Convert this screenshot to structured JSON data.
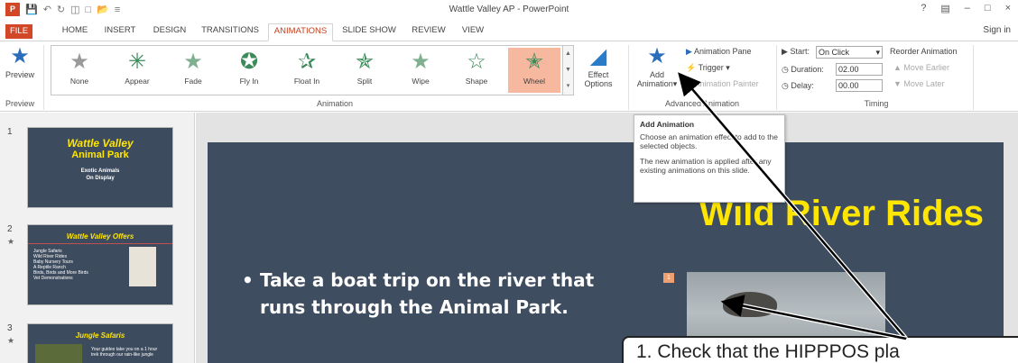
{
  "window": {
    "title": "Wattle Valley AP - PowerPoint",
    "help": "?",
    "controls": [
      "–",
      "□",
      "×"
    ]
  },
  "tabs": [
    "FILE",
    "HOME",
    "INSERT",
    "DESIGN",
    "TRANSITIONS",
    "ANIMATIONS",
    "SLIDE SHOW",
    "REVIEW",
    "VIEW"
  ],
  "active_tab": "ANIMATIONS",
  "signin": "Sign in",
  "ribbon": {
    "preview": {
      "label": "Preview",
      "group": "Preview"
    },
    "animations": [
      "None",
      "Appear",
      "Fade",
      "Fly In",
      "Float In",
      "Split",
      "Wipe",
      "Shape",
      "Wheel"
    ],
    "selected_animation": "Wheel",
    "effect_options": [
      "Effect",
      "Options"
    ],
    "animation_group": "Animation",
    "add_animation": [
      "Add",
      "Animation"
    ],
    "animation_pane": "Animation Pane",
    "trigger": "Trigger",
    "animation_painter": "Animation Painter",
    "advanced_group": "Advanced Animation",
    "start_label": "Start:",
    "start_value": "On Click",
    "duration_label": "Duration:",
    "duration_value": "02.00",
    "delay_label": "Delay:",
    "delay_value": "00.00",
    "reorder_label": "Reorder Animation",
    "move_earlier": "Move Earlier",
    "move_later": "Move Later",
    "timing_group": "Timing"
  },
  "tooltip": {
    "title": "Add Animation",
    "line1": "Choose an animation effect to add to the selected objects.",
    "line2": "The new animation is applied after any existing animations on this slide."
  },
  "thumbnails": [
    {
      "num": "1",
      "title": "Wattle Valley",
      "subtitle": "Animal Park",
      "text": [
        "Exotic Animals",
        "On Display"
      ]
    },
    {
      "num": "2",
      "title": "Wattle Valley Offers",
      "items": [
        "Jungle Safaris",
        "Wild River Rides",
        "Baby Nursery Tours",
        "A Reptile Ranch",
        "Birds, Birds and More Birds",
        "Vet Demonstrations"
      ]
    },
    {
      "num": "3",
      "title": "Jungle Safaris",
      "text": "Your guides take you on a 1 hour trek through our rain-like jungle"
    }
  ],
  "slide": {
    "title": "Wild River Rides",
    "bullet": "Take a boat trip on the river that runs through the Animal Park.",
    "animation_tag": "1"
  },
  "callout": "1. Check that the HIPPPOS pla"
}
